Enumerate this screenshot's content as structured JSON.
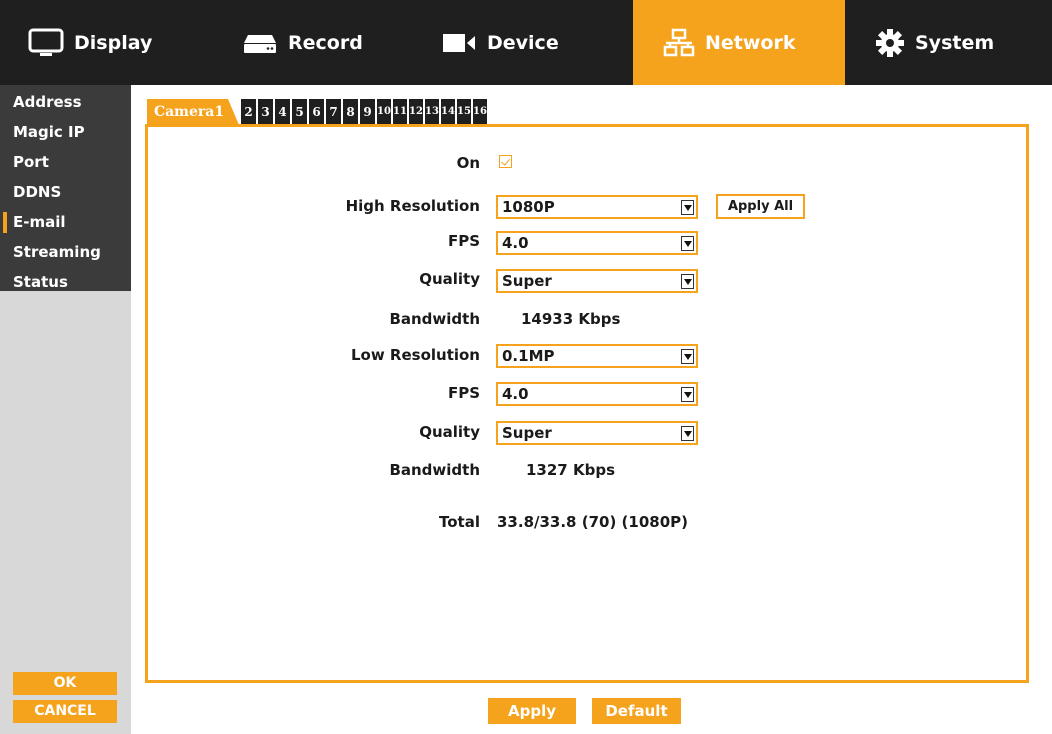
{
  "topnav": {
    "tabs": [
      {
        "label": "Display",
        "icon": "monitor-icon"
      },
      {
        "label": "Record",
        "icon": "dvr-icon"
      },
      {
        "label": "Device",
        "icon": "camera-icon"
      },
      {
        "label": "Network",
        "icon": "network-icon",
        "active": true
      },
      {
        "label": "System",
        "icon": "gear-icon"
      }
    ]
  },
  "sidebar": {
    "items": [
      {
        "label": "Address"
      },
      {
        "label": "Magic IP"
      },
      {
        "label": "Port"
      },
      {
        "label": "DDNS"
      },
      {
        "label": "E-mail",
        "active": true
      },
      {
        "label": "Streaming"
      },
      {
        "label": "Status"
      }
    ],
    "ok_label": "OK",
    "cancel_label": "CANCEL"
  },
  "camera_tabs": [
    "Camera1",
    "2",
    "3",
    "4",
    "5",
    "6",
    "7",
    "8",
    "9",
    "10",
    "11",
    "12",
    "13",
    "14",
    "15",
    "16"
  ],
  "form": {
    "on_label": "On",
    "on_checked": true,
    "high_resolution": {
      "label": "High Resolution",
      "value": "1080P"
    },
    "apply_all_label": "Apply All",
    "high_fps": {
      "label": "FPS",
      "value": "4.0"
    },
    "high_quality": {
      "label": "Quality",
      "value": "Super"
    },
    "high_bandwidth": {
      "label": "Bandwidth",
      "value": "14933 Kbps"
    },
    "low_resolution": {
      "label": "Low Resolution",
      "value": "0.1MP"
    },
    "low_fps": {
      "label": "FPS",
      "value": "4.0"
    },
    "low_quality": {
      "label": "Quality",
      "value": "Super"
    },
    "low_bandwidth": {
      "label": "Bandwidth",
      "value": "1327 Kbps"
    },
    "total": {
      "label": "Total",
      "value": "33.8/33.8 (70) (1080P)"
    }
  },
  "footer": {
    "apply_label": "Apply",
    "default_label": "Default"
  },
  "colors": {
    "accent": "#f5a21c",
    "nav_bg": "#1f1f1f",
    "sidebar_bg": "#3b3b3b",
    "sidebar_lower_bg": "#d8d8d8"
  }
}
